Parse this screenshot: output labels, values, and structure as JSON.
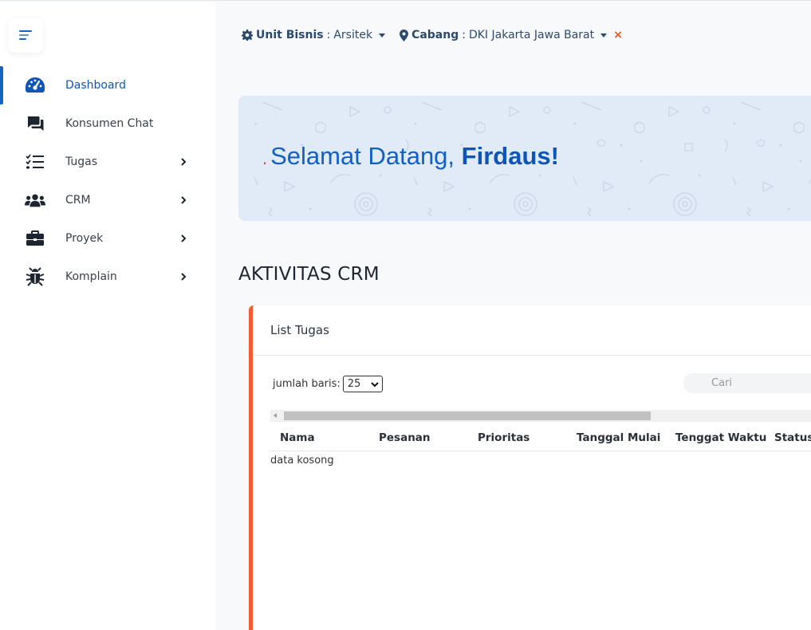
{
  "sidebar": {
    "items": [
      {
        "label": "Dashboard",
        "icon": "dashboard-gauge-icon",
        "active": true,
        "has_submenu": false
      },
      {
        "label": "Konsumen Chat",
        "icon": "chat-icon",
        "active": false,
        "has_submenu": false
      },
      {
        "label": "Tugas",
        "icon": "tasks-list-icon",
        "active": false,
        "has_submenu": true
      },
      {
        "label": "CRM",
        "icon": "users-icon",
        "active": false,
        "has_submenu": true
      },
      {
        "label": "Proyek",
        "icon": "briefcase-icon",
        "active": false,
        "has_submenu": true
      },
      {
        "label": "Komplain",
        "icon": "bug-icon",
        "active": false,
        "has_submenu": true
      }
    ]
  },
  "header": {
    "unit_label": "Unit Bisnis",
    "unit_value": "Arsitek",
    "branch_label": "Cabang",
    "branch_value": "DKI Jakarta Jawa Barat",
    "separator": ":",
    "clear": "×"
  },
  "banner": {
    "greeting": "Selamat Datang,",
    "name": "Firdaus!",
    "dot": "."
  },
  "section_title": "AKTIVITAS CRM",
  "card": {
    "title": "List Tugas",
    "rows_label": "jumlah baris:",
    "rows_value": "25",
    "search_placeholder": "Cari",
    "columns": [
      "Nama",
      "Pesanan",
      "Prioritas",
      "Tanggal Mulai",
      "Tenggat Waktu",
      "Status"
    ],
    "empty_text": "data kosong"
  },
  "colors": {
    "primary": "#1160c8",
    "accent": "#f25a31",
    "banner_bg": "#e1eaf7",
    "clear_x": "#e8562a"
  }
}
